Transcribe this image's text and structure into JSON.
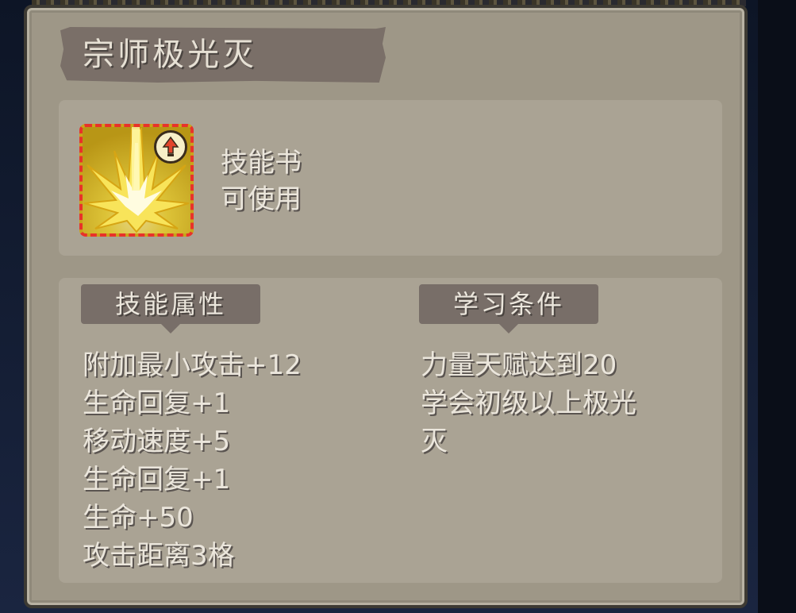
{
  "skill": {
    "title": "宗师极光灭",
    "type_line": "技能书",
    "usable_line": "可使用",
    "icon": "golden-burst-skill-icon",
    "badge_icon": "upgrade-arrow-badge-icon"
  },
  "attributes": {
    "header": "技能属性",
    "items": [
      "附加最小攻击+12",
      "生命回复+1",
      "移动速度+5",
      "生命回复+1",
      "生命+50",
      "攻击距离3格"
    ]
  },
  "requirements": {
    "header": "学习条件",
    "items": [
      "力量天赋达到20",
      "学会初级以上极光",
      "灭"
    ]
  },
  "colors": {
    "panel": "#9e9787",
    "inner_box": "#aaa394",
    "banner": "#7a6f68",
    "text": "#ebe6dc",
    "icon_border": "#e8322a"
  }
}
